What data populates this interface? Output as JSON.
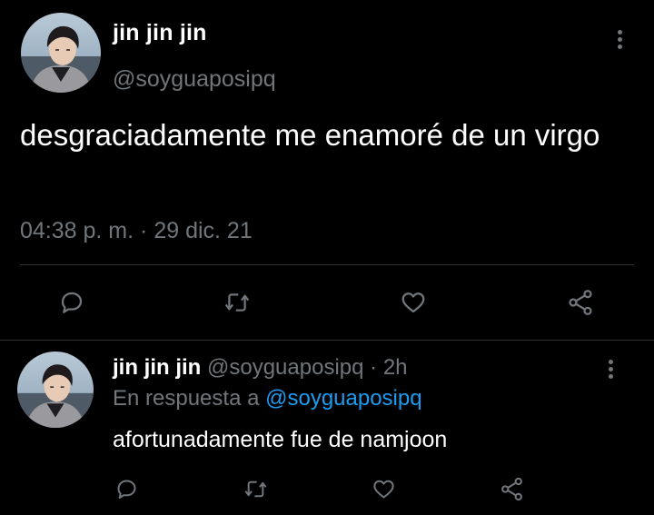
{
  "main_tweet": {
    "display_name": "jin jin jin",
    "handle": "@soyguaposipq",
    "text": "desgraciadamente me enamoré de un virgo",
    "time": "04:38 p. m.",
    "separator": "·",
    "date": "29 dic. 21",
    "avatar_icon": "profile-photo",
    "more_icon": "more-vertical-icon",
    "actions": [
      "reply-icon",
      "retweet-icon",
      "like-icon",
      "share-icon"
    ]
  },
  "reply_tweet": {
    "display_name": "jin jin jin",
    "handle": "@soyguaposipq",
    "separator": "·",
    "time_ago": "2h",
    "reply_prefix": "En respuesta a",
    "reply_to_handle": "@soyguaposipq",
    "text": "afortunadamente fue de namjoon",
    "avatar_icon": "profile-photo",
    "more_icon": "more-vertical-icon",
    "actions": [
      "reply-icon",
      "retweet-icon",
      "like-icon",
      "share-icon"
    ]
  },
  "colors": {
    "background": "#000000",
    "primary_text": "#ffffff",
    "secondary_text": "#71767b",
    "link": "#1d9bf0",
    "divider": "#2f3336"
  }
}
